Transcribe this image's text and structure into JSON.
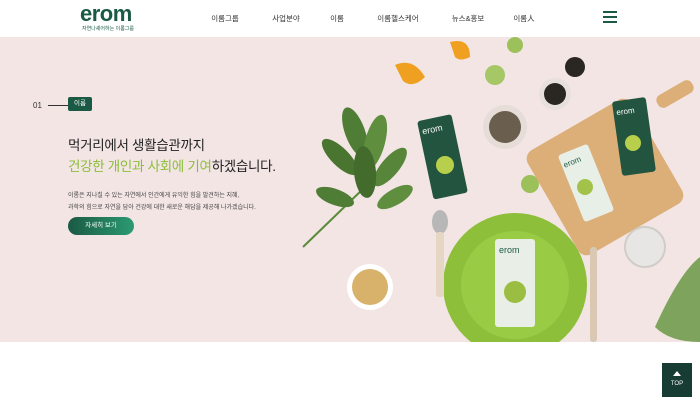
{
  "brand": {
    "logo_text": "erom",
    "logo_sub": "자연나셰어하는 이롬그룹"
  },
  "nav": {
    "items": [
      "이롬그룹",
      "사업분야",
      "이롬",
      "이롬헬스케어",
      "뉴스&홍보",
      "이롬人"
    ]
  },
  "hero": {
    "slide_number": "01",
    "tag": "이롬",
    "headline_line1": "먹거리에서 생활습관까지",
    "headline_highlight": "건강한 개인과 사회에 기여",
    "headline_rest": "하겠습니다.",
    "description_line1": "이롬은 지나칠 수 있는 자연에서 인간에게 유익한 힘을 발견하는 지혜,",
    "description_line2": "과학의 힘으로 자연을 담아 건강에 대한 새로운 해답을 제공해 나가겠습니다.",
    "more_button": "자세히 보기"
  },
  "product": {
    "brand_text": "erom"
  },
  "top_button": {
    "label": "TOP"
  },
  "colors": {
    "brand_green": "#1a5a44",
    "highlight_green": "#8dbe3a",
    "hero_bg": "#f2e5e4",
    "top_button_bg": "#163c33"
  }
}
